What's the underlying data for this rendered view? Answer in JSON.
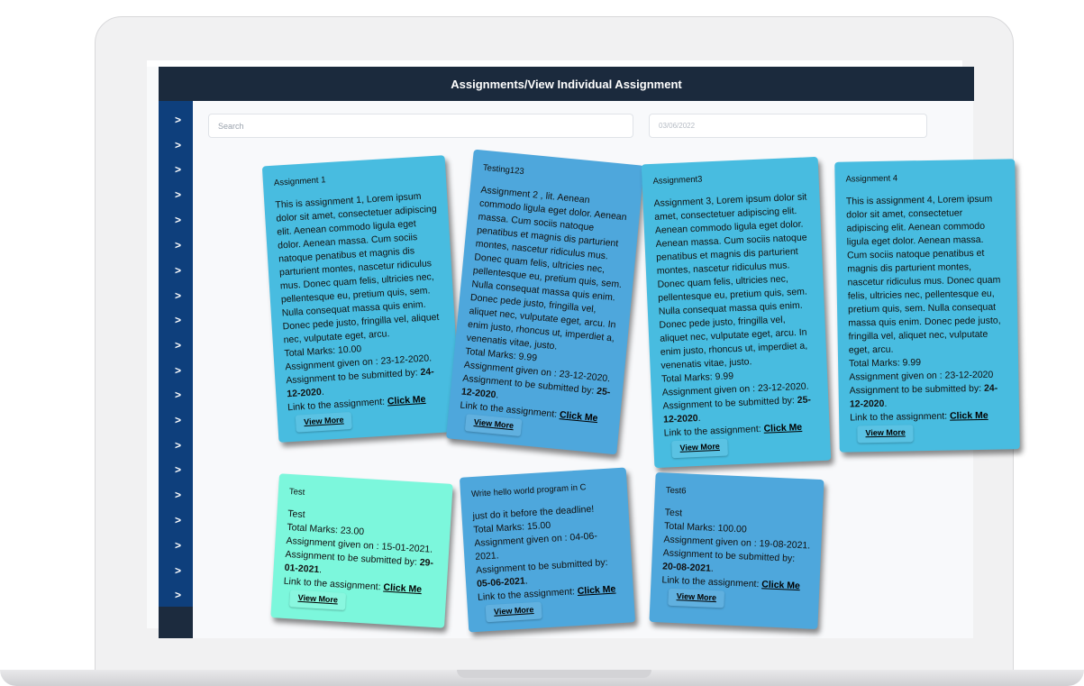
{
  "header": {
    "title": "Assignments/View Individual Assignment"
  },
  "sidebar": {
    "items": [
      ">",
      ">",
      ">",
      ">",
      ">",
      ">",
      ">",
      ">",
      ">",
      ">",
      ">",
      ">",
      ">",
      ">",
      ">",
      ">",
      ">",
      ">",
      ">",
      ">"
    ]
  },
  "filters": {
    "search_placeholder": "Search",
    "date_value": "03/06/2022"
  },
  "labels": {
    "total_marks": "Total Marks: ",
    "given_on": "Assignment given on : ",
    "submit_by": "Assignment to be submitted by: ",
    "link": "Link to the assignment: ",
    "click_me": "Click Me",
    "view_more": "View More"
  },
  "cards": [
    {
      "title": "Assignment 1",
      "desc": "This is assignment 1, Lorem ipsum dolor sit amet, consectetuer adipiscing elit. Aenean commodo ligula eget dolor. Aenean massa. Cum sociis natoque penatibus et magnis dis parturient montes, nascetur ridiculus mus. Donec quam felis, ultricies nec, pellentesque eu, pretium quis, sem. Nulla consequat massa quis enim. Donec pede justo, fringilla vel, aliquet nec, vulputate eget, arcu.",
      "marks": "10.00",
      "given": "23-12-2020.",
      "due": "24-12-2020",
      "color": "#48bce0"
    },
    {
      "title": "Testing123",
      "desc": "Assignment 2 , lit. Aenean commodo ligula eget dolor. Aenean massa. Cum sociis natoque penatibus et magnis dis parturient montes, nascetur ridiculus mus. Donec quam felis, ultricies nec, pellentesque eu, pretium quis, sem. Nulla consequat massa quis enim. Donec pede justo, fringilla vel, aliquet nec, vulputate eget, arcu. In enim justo, rhoncus ut, imperdiet a, venenatis vitae, justo.",
      "marks": "9.99",
      "given": "23-12-2020.",
      "due": "25-12-2020",
      "color": "#4ea7dc"
    },
    {
      "title": "Assignment3",
      "desc": "Assignment 3, Lorem ipsum dolor sit amet, consectetuer adipiscing elit. Aenean commodo ligula eget dolor. Aenean massa. Cum sociis natoque penatibus et magnis dis parturient montes, nascetur ridiculus mus. Donec quam felis, ultricies nec, pellentesque eu, pretium quis, sem. Nulla consequat massa quis enim. Donec pede justo, fringilla vel, aliquet nec, vulputate eget, arcu. In enim justo, rhoncus ut, imperdiet a, venenatis vitae, justo.",
      "marks": "9.99",
      "given": "23-12-2020.",
      "due": "25-12-2020",
      "color": "#48bce0"
    },
    {
      "title": "Assignment 4",
      "desc": "This is assignment 4, Lorem ipsum dolor sit amet, consectetuer adipiscing elit. Aenean commodo ligula eget dolor. Aenean massa. Cum sociis natoque penatibus et magnis dis parturient montes, nascetur ridiculus mus. Donec quam felis, ultricies nec, pellentesque eu, pretium quis, sem. Nulla consequat massa quis enim. Donec pede justo, fringilla vel, aliquet nec, vulputate eget, arcu.",
      "marks": "9.99",
      "given": "23-12-2020",
      "due": "24-12-2020",
      "color": "#48bce0"
    },
    {
      "title": "Test",
      "desc": "Test",
      "marks": "23.00",
      "given": "15-01-2021.",
      "due": "29-01-2021",
      "color": "#7cf7dc"
    },
    {
      "title": "Write hello world program in C",
      "desc": "just do it before the deadline!",
      "marks": "15.00",
      "given": "04-06-2021.",
      "due": "05-06-2021",
      "color": "#4ea7dc"
    },
    {
      "title": "Test6",
      "desc": "Test",
      "marks": "100.00",
      "given": "19-08-2021.",
      "due": "20-08-2021",
      "color": "#4ea7dc"
    }
  ]
}
